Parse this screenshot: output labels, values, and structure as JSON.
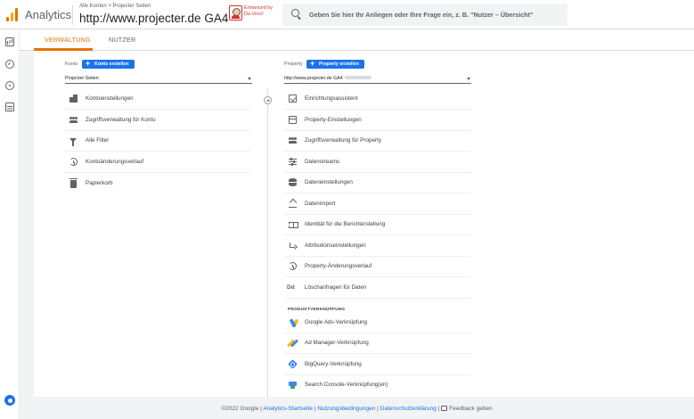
{
  "header": {
    "app_name": "Analytics",
    "breadcrumb": "Alle Konten > Projecter Seiten",
    "property_name": "http://www.projecter.de GA4",
    "caret": "▼",
    "extension_text_line1": "Enhanced by",
    "extension_text_line2": "Da Vinci!",
    "search_placeholder": "Geben Sie hier Ihr Anliegen oder Ihre Frage ein, z. B. \"Nutzer – Übersicht\""
  },
  "tabs": [
    {
      "label": "VERWALTUNG",
      "active": true
    },
    {
      "label": "NUTZER",
      "active": false
    }
  ],
  "account": {
    "label": "Konto",
    "create_button": "Konto erstellen",
    "selected": "Projecter Seiten",
    "items": [
      {
        "label": "Kontoeinstellungen",
        "icon": "building-icon"
      },
      {
        "label": "Zugriffsverwaltung für Konto",
        "icon": "people-icon"
      },
      {
        "label": "Alle Filter",
        "icon": "filter-icon"
      },
      {
        "label": "Kontoänderungsverlauf",
        "icon": "history-icon"
      },
      {
        "label": "Papierkorb",
        "icon": "trash-icon"
      }
    ]
  },
  "property": {
    "label": "Property",
    "create_button": "Property erstellen",
    "selected": "http://www.projecter.de GA4",
    "items": [
      {
        "label": "Einrichtungsassistent",
        "icon": "checkbox-icon"
      },
      {
        "label": "Property-Einstellungen",
        "icon": "window-icon"
      },
      {
        "label": "Zugriffsverwaltung für Property",
        "icon": "people-icon"
      },
      {
        "label": "Datenstreams",
        "icon": "streams-icon"
      },
      {
        "label": "Dateneinstellungen",
        "icon": "database-icon"
      },
      {
        "label": "Datenimport",
        "icon": "upload-icon"
      },
      {
        "label": "Identität für die Berichterstellung",
        "icon": "identity-icon"
      },
      {
        "label": "Attributionseinstellungen",
        "icon": "attribution-icon"
      },
      {
        "label": "Property-Änderungsverlauf",
        "icon": "history-icon"
      },
      {
        "label": "Löschanfragen für Daten",
        "icon": "dd-icon",
        "icon_text": "Dd"
      }
    ],
    "section_heading": "PRODUKTVERKNÜPFUNG",
    "links": [
      {
        "label": "Google Ads-Verknüpfung",
        "icon": "google-ads-icon"
      },
      {
        "label": "Ad Manager-Verknüpfung",
        "icon": "ad-manager-icon"
      },
      {
        "label": "BigQuery-Verknüpfung",
        "icon": "bigquery-icon"
      },
      {
        "label": "Search Console-Verknüpfung(en)",
        "icon": "search-console-icon"
      }
    ]
  },
  "footer": {
    "copyright": "©2022 Google",
    "sep": "|",
    "link1": "Analytics-Startseite",
    "link2": "Nutzungsbedingungen",
    "link3": "Datenschutzerklärung",
    "feedback": "Feedback geben"
  },
  "colors": {
    "accent": "#e37400",
    "primary": "#1a73e8"
  }
}
